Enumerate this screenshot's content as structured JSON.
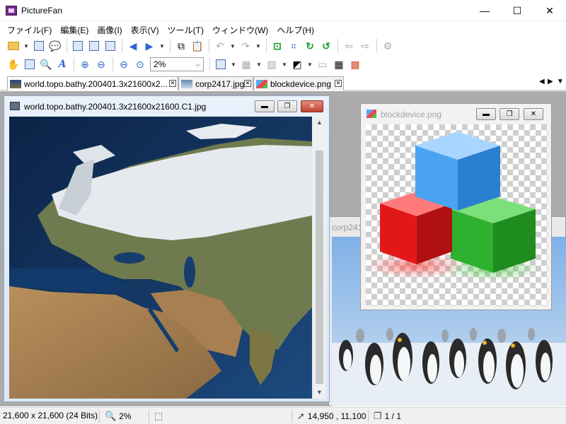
{
  "app": {
    "title": "PictureFan",
    "minimize_glyph": "—",
    "maximize_glyph": "☐",
    "close_glyph": "✕"
  },
  "menu": [
    {
      "label": "ファイル(F)"
    },
    {
      "label": "編集(E)"
    },
    {
      "label": "画像(I)"
    },
    {
      "label": "表示(V)"
    },
    {
      "label": "ツール(T)"
    },
    {
      "label": "ウィンドウ(W)"
    },
    {
      "label": "ヘルプ(H)"
    }
  ],
  "toolbar": {
    "zoom_value": "2%"
  },
  "tabs": [
    {
      "label": "world.topo.bathy.200401.3x21600x2...",
      "active": true
    },
    {
      "label": "corp2417.jpg",
      "active": false
    },
    {
      "label": "blockdevice.png",
      "active": false
    }
  ],
  "windows": {
    "world": {
      "title": "world.topo.bathy.200401.3x21600x21600.C1.jpg"
    },
    "corp": {
      "title": "corp2417"
    },
    "block": {
      "title": "blockdevice.png"
    }
  },
  "status": {
    "dimensions": "21,600 x 21,600 (24 Bits)",
    "zoom": "2%",
    "coords": "14,950 , 11,100",
    "page": "1 / 1"
  },
  "colors": {
    "accent": "#2a67c9",
    "close_button": "#c2432e"
  }
}
